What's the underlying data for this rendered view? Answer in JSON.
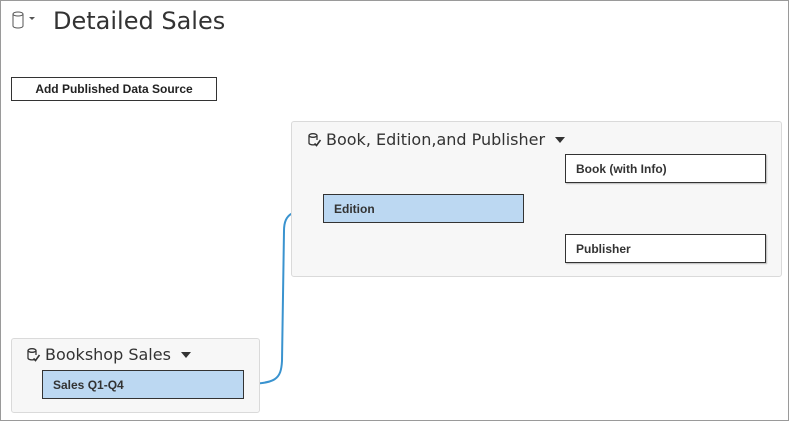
{
  "page": {
    "title": "Detailed Sales",
    "icon": "database-cylinder-icon",
    "add_button_label": "Add Published Data Source"
  },
  "colors": {
    "blue_table": "#bcd8f2",
    "relationship_line": "#3a93cf",
    "join_line": "#555555"
  },
  "sources": {
    "publisher_source": {
      "name": "Book, Edition,and Publisher",
      "icon": "published-datasource-icon",
      "tables": {
        "edition": "Edition",
        "book": "Book (with Info)",
        "publisher": "Publisher"
      }
    },
    "bookshop_source": {
      "name": "Bookshop Sales",
      "icon": "published-datasource-icon",
      "tables": {
        "sales": "Sales Q1-Q4"
      }
    }
  }
}
